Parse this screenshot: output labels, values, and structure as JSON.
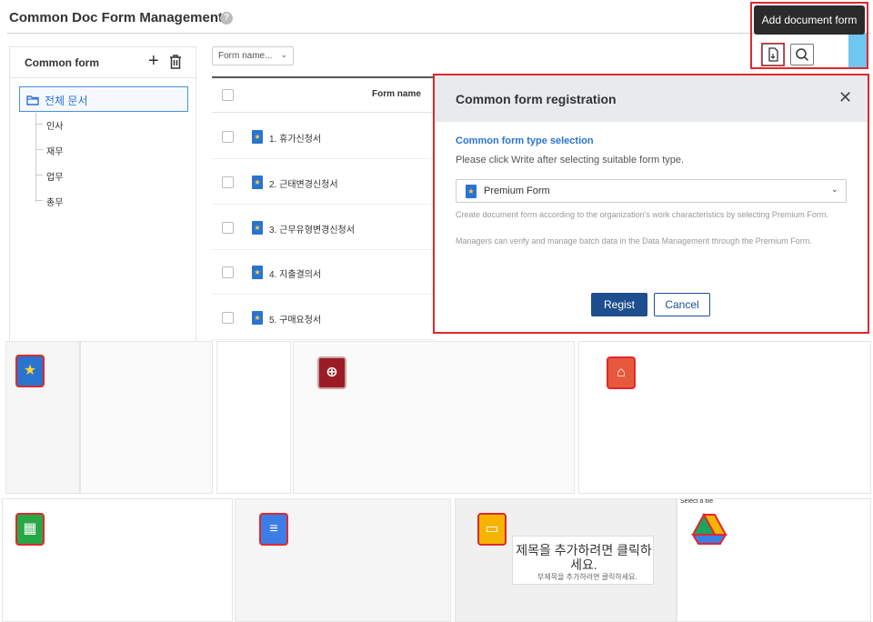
{
  "page": {
    "title": "Common Doc Form Management",
    "help_icon": "?"
  },
  "toolbar": {
    "tooltip": "Add document form",
    "add_icon": "add-document-icon",
    "search_icon": "search-icon"
  },
  "sidebar": {
    "title": "Common form",
    "root": "전체 문서",
    "items": [
      "인사",
      "재무",
      "업무",
      "총무"
    ]
  },
  "filter": {
    "selected": "Form name..."
  },
  "table": {
    "header": "Form name",
    "rows": [
      "1. 휴가신청서",
      "2. 근태변경신청서",
      "3. 근무유형변경신청서",
      "4. 지출결의서",
      "5. 구매요청서"
    ]
  },
  "modal": {
    "title": "Common form registration",
    "section_title": "Common form type selection",
    "section_desc": "Please click Write after selecting suitable form type.",
    "selected_type": "Premium Form",
    "note1": "Create document form according to the organization's work characteristics by selecting Premium Form.",
    "note2": "Managers can verify and manage batch data in the Data Management through the Premium Form.",
    "regist": "Regist",
    "cancel": "Cancel"
  },
  "previews": {
    "slides_title": "제목을 추가하려면 클릭하세요.",
    "slides_subtitle": "부제목을 추가하려면 클릭하세요.",
    "drive_title": "Select a file"
  },
  "colors": {
    "accent": "#2a74d0",
    "primary_button": "#1d4f8f",
    "highlight": "#e0282e"
  }
}
